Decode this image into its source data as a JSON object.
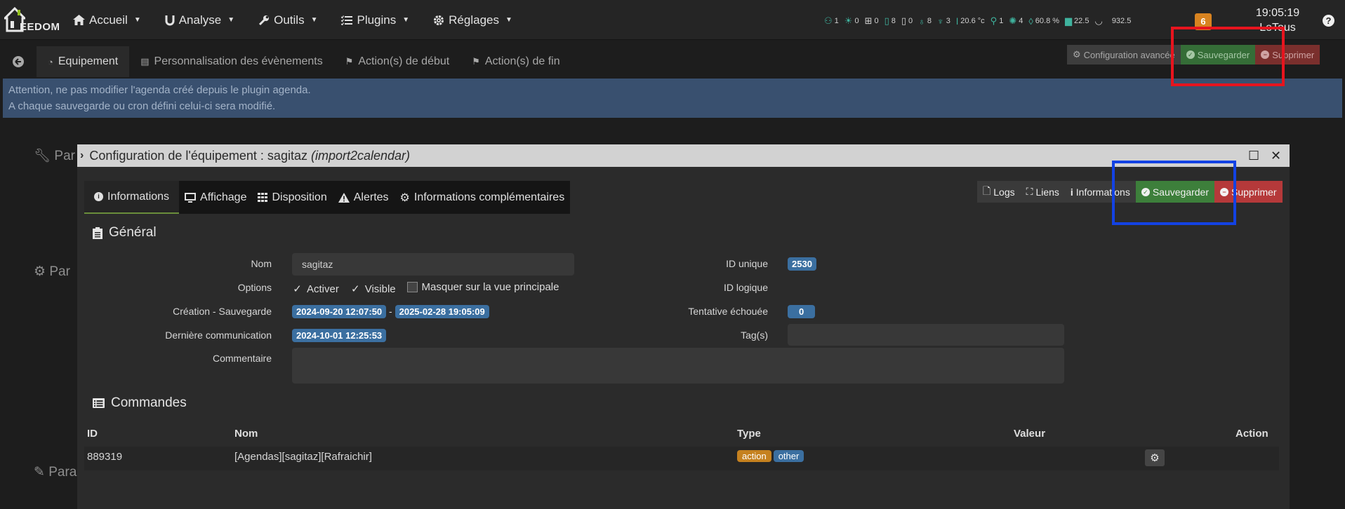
{
  "navbar": {
    "brand": "EEDOM",
    "menu": [
      {
        "label": "Accueil",
        "icon": "home-icon"
      },
      {
        "label": "Analyse",
        "icon": "magnet-icon"
      },
      {
        "label": "Outils",
        "icon": "wrench-icon"
      },
      {
        "label": "Plugins",
        "icon": "list-check-icon"
      },
      {
        "label": "Réglages",
        "icon": "gear-icon"
      }
    ],
    "summary": [
      {
        "icon": "user-icon",
        "value": "1"
      },
      {
        "icon": "lamp-icon",
        "value": "0"
      },
      {
        "icon": "window-icon",
        "value": "0"
      },
      {
        "icon": "door-icon",
        "value": "8"
      },
      {
        "icon": "shutter-icon",
        "value": "0"
      },
      {
        "icon": "bulb-icon",
        "value": "8"
      },
      {
        "icon": "plug-icon",
        "value": "3"
      },
      {
        "icon": "thermometer-icon",
        "value": "20.6 °c"
      },
      {
        "icon": "motion-icon",
        "value": "1"
      },
      {
        "icon": "sun-icon",
        "value": "4"
      },
      {
        "icon": "humidity-icon",
        "value": "60.8 %"
      },
      {
        "icon": "energy-icon",
        "value": "22.5"
      },
      {
        "icon": "spinner-icon",
        "value": "932.5"
      }
    ],
    "notifications": "6",
    "time": "19:05:19",
    "profile": "LeTous"
  },
  "tabbar": {
    "tabs": [
      {
        "label": "Equipement",
        "icon": "dashboard-icon"
      },
      {
        "label": "Personnalisation des évènements",
        "icon": "sign-icon"
      },
      {
        "label": "Action(s) de début",
        "icon": "flag-icon"
      },
      {
        "label": "Action(s) de fin",
        "icon": "flag-icon"
      }
    ],
    "actions": {
      "config": "Configuration avancée",
      "save": "Sauvegarder",
      "delete": "Supprimer"
    }
  },
  "alert": {
    "line1": "Attention, ne pas modifier l'agenda créé depuis le plugin agenda.",
    "line2": "A chaque sauvegarde ou cron défini celui-ci sera modifié."
  },
  "background_labels": {
    "p1": "Par",
    "p2": "Par",
    "p3": "Para"
  },
  "modal": {
    "title": "Configuration de l'équipement : sagitaz",
    "title_plugin": "(import2calendar)",
    "tabs": [
      "Informations",
      "Affichage",
      "Disposition",
      "Alertes",
      "Informations complémentaires"
    ],
    "actions": {
      "logs": "Logs",
      "links": "Liens",
      "infos": "Informations",
      "save": "Sauvegarder",
      "delete": "Supprimer"
    },
    "general": {
      "title": "Général",
      "name_label": "Nom",
      "name_value": "sagitaz",
      "options_label": "Options",
      "opt_activate": "Activer",
      "opt_visible": "Visible",
      "opt_hide": "Masquer sur la vue principale",
      "created_label": "Création - Sauvegarde",
      "created": "2024-09-20 12:07:50",
      "sep": "-",
      "saved": "2025-02-28 19:05:09",
      "lastcom_label": "Dernière communication",
      "lastcom": "2024-10-01 12:25:53",
      "comment_label": "Commentaire",
      "id_label": "ID unique",
      "id_value": "2530",
      "logical_label": "ID logique",
      "failed_label": "Tentative échouée",
      "failed_value": "0",
      "tags_label": "Tag(s)"
    },
    "commands": {
      "title": "Commandes",
      "headers": {
        "id": "ID",
        "name": "Nom",
        "type": "Type",
        "value": "Valeur",
        "action": "Action"
      },
      "rows": [
        {
          "id": "889319",
          "name": "[Agendas][sagitaz][Rafraichir]",
          "type": "action",
          "subtype": "other"
        }
      ]
    }
  }
}
